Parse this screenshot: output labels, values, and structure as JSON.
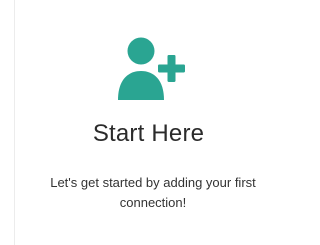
{
  "empty_state": {
    "icon": "add-user-icon",
    "accent_color": "#2aa592",
    "title": "Start Here",
    "message": "Let's get started by adding your first connection!"
  }
}
